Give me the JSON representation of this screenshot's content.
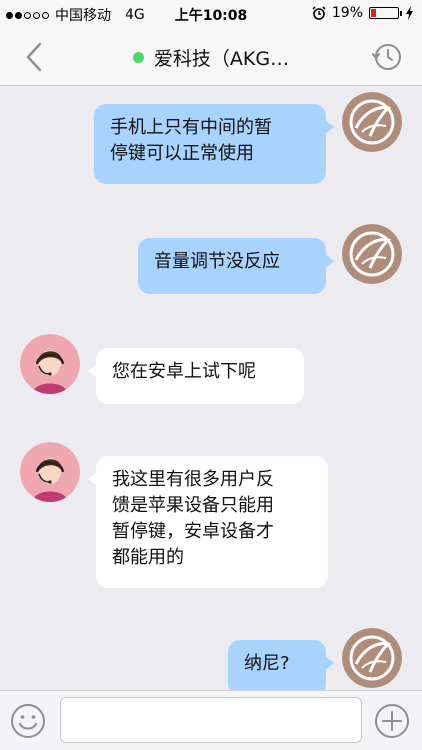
{
  "status_bar": {
    "carrier": "中国移动",
    "network": "4G",
    "time": "上午10:08",
    "battery_percent": "19%",
    "signal_bars": 2,
    "battery_level": 0.19
  },
  "header": {
    "title": "爱科技（AKG…",
    "online_color": "#4cd964"
  },
  "messages": [
    {
      "side": "out",
      "text": "手机上只有中间的暂\n停键可以正常使用"
    },
    {
      "side": "out",
      "text": "音量调节没反应"
    },
    {
      "side": "in",
      "text": "您在安卓上试下呢"
    },
    {
      "side": "in",
      "text": "我这里有很多用户反\n馈是苹果设备只能用\n暂停键，安卓设备才\n都能用的"
    },
    {
      "side": "out",
      "text": "纳尼?"
    }
  ],
  "input": {
    "value": "",
    "placeholder": ""
  },
  "icons": {
    "back": "chevron-left-icon",
    "history": "clock-history-icon",
    "emoji": "smiley-icon",
    "add": "plus-circle-icon",
    "alarm": "alarm-clock-icon",
    "charging": "lightning-icon"
  },
  "colors": {
    "outgoing_bubble": "#a9d3ff",
    "incoming_bubble": "#ffffff",
    "chat_background": "#ebebf0",
    "battery_low": "#e22222"
  }
}
